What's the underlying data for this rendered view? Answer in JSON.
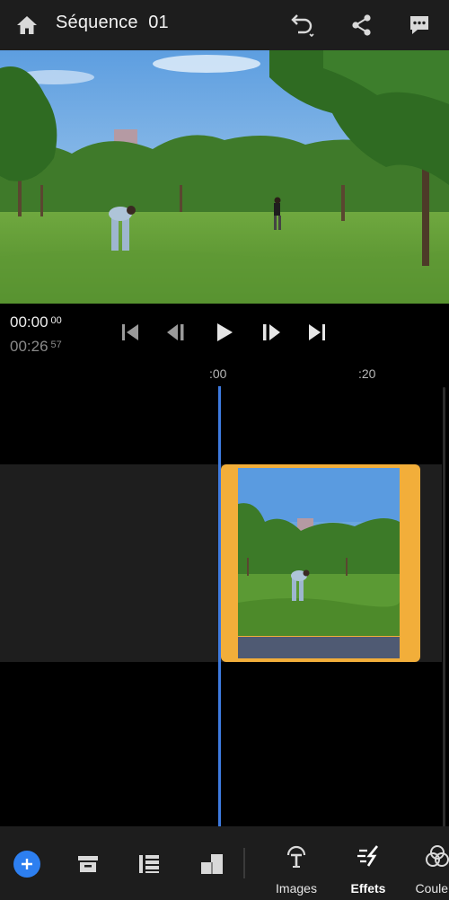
{
  "header": {
    "title": "Séquence  01",
    "home_icon": "home-icon",
    "undo_icon": "undo-icon",
    "share_icon": "share-icon",
    "comment_icon": "comment-icon"
  },
  "preview": {
    "description_icon": "video-frame"
  },
  "transport": {
    "current_time": "00:00",
    "current_frames": "00",
    "total_time": "00:26",
    "total_frames": "57",
    "buttons": [
      "skip-to-start-icon",
      "step-back-icon",
      "play-icon",
      "step-forward-icon",
      "skip-to-end-icon"
    ]
  },
  "timeline": {
    "ruler": [
      ":00",
      ":20"
    ]
  },
  "toolbar": {
    "left_tools": [
      "add-media-icon",
      "archive-icon",
      "clip-list-icon",
      "aspect-ratio-icon"
    ],
    "labeled_tools": [
      {
        "label": "Images",
        "icon": "images-text-icon"
      },
      {
        "label": "Effets",
        "icon": "effects-icon"
      },
      {
        "label": "Couleur",
        "icon": "color-icon"
      }
    ],
    "active": "Effets"
  },
  "colors": {
    "accent_blue": "#2d7ff0",
    "playhead": "#3e7be0",
    "clip_selected": "#f2ae3a",
    "header_bg": "#1d1d1d"
  }
}
